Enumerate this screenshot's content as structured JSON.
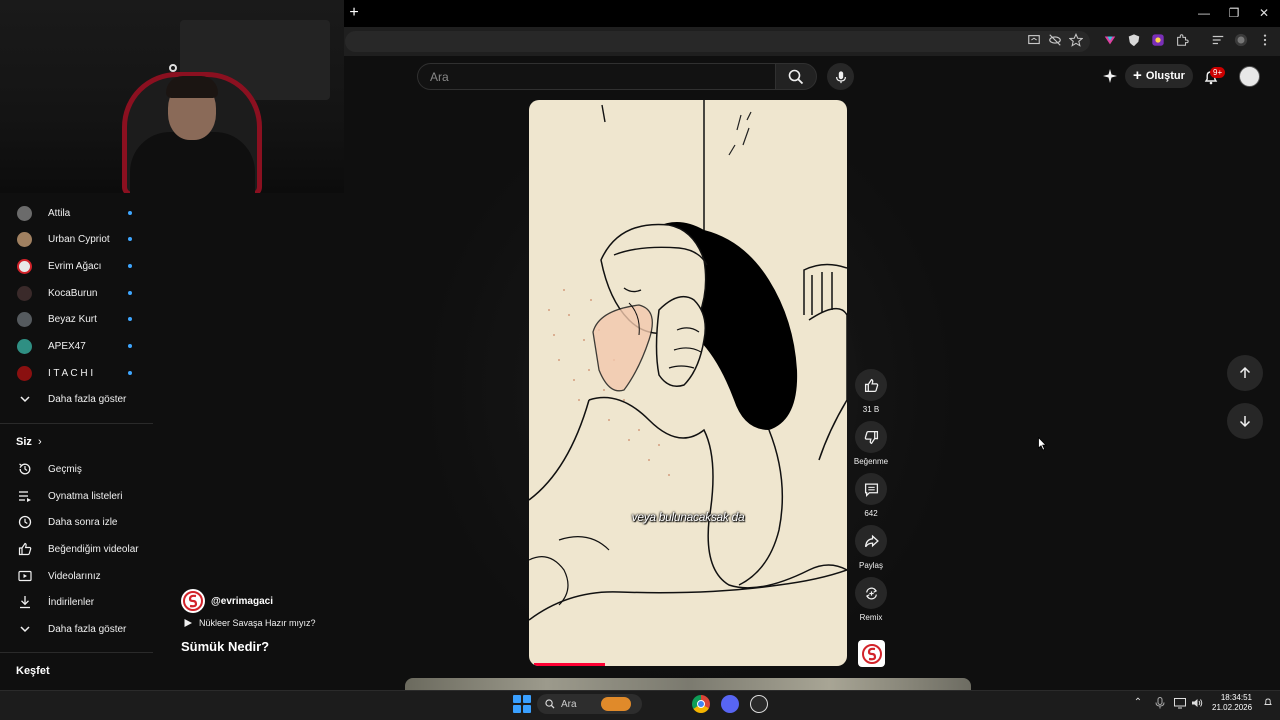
{
  "browser": {
    "new_tab_label": "+",
    "window_controls": [
      "—",
      "❐",
      "✕"
    ]
  },
  "header": {
    "search": {
      "placeholder": "Ara",
      "value": ""
    },
    "create_label": "Oluştur",
    "notification_badge": "9+"
  },
  "sidebar": {
    "subscriptions": [
      {
        "label": "Attila",
        "avatar_color": "#6b6b6b",
        "new": true
      },
      {
        "label": "Urban Cypriot",
        "avatar_color": "#a08060",
        "new": true
      },
      {
        "label": "Evrim Ağacı",
        "avatar_color": "#e8e8e8",
        "new": true
      },
      {
        "label": "KocaBurun",
        "avatar_color": "#3a2a2a",
        "new": true
      },
      {
        "label": "Beyaz Kurt",
        "avatar_color": "#555a5e",
        "new": true
      },
      {
        "label": "APEX47",
        "avatar_color": "#2f8f83",
        "new": true
      },
      {
        "label": "I T A C H I",
        "avatar_color": "#8a1010",
        "new": true
      }
    ],
    "show_more_subs": "Daha fazla göster",
    "you_section": {
      "title": "Siz",
      "chevron": "›"
    },
    "you_items": [
      {
        "label": "Geçmiş",
        "icon": "history-icon"
      },
      {
        "label": "Oynatma listeleri",
        "icon": "playlist-icon"
      },
      {
        "label": "Daha sonra izle",
        "icon": "watch-later-icon"
      },
      {
        "label": "Beğendiğim videolar",
        "icon": "like-icon"
      },
      {
        "label": "Videolarınız",
        "icon": "your-videos-icon"
      },
      {
        "label": "İndirilenler",
        "icon": "download-icon"
      }
    ],
    "show_more_you": "Daha fazla göster",
    "explore_title": "Keşfet"
  },
  "short": {
    "caption": "veya bulunacaksak da",
    "progress_fraction": 0.23,
    "channel_handle": "@evrimagaci",
    "related_video": "Nükleer Savaşa Hazır mıyız?",
    "title": "Sümük Nedir?",
    "actions": {
      "like_count": "31 B",
      "dislike_label": "Beğenme",
      "comment_count": "642",
      "share_label": "Paylaş",
      "remix_label": "Remix"
    }
  },
  "taskbar": {
    "search_label": "Ara",
    "time": "18:34:51",
    "date": "21.02.2026"
  },
  "colors": {
    "accent_red": "#ff0033",
    "link_blue": "#3ea6ff",
    "page_bg": "#0f0f0f"
  }
}
